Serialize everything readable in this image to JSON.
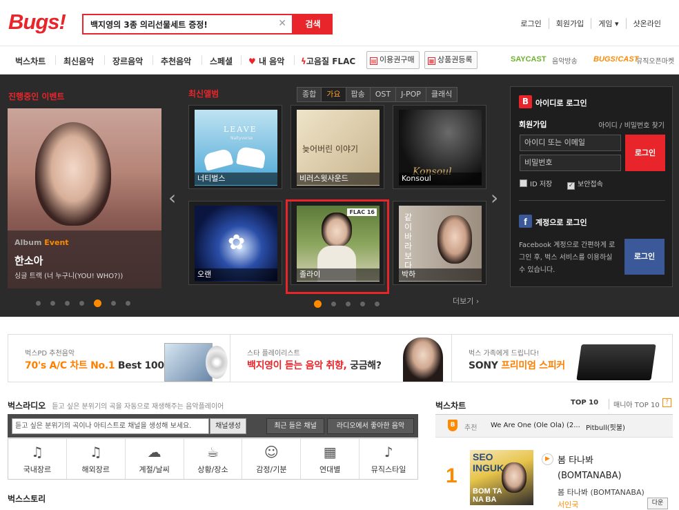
{
  "header": {
    "logo": "Bugs!",
    "search_value": "백지영의 3종 의리선물세트 증정!",
    "search_button": "검색",
    "links": [
      "로그인",
      "회원가입",
      "게임 ▾",
      "샷온라인"
    ]
  },
  "nav": {
    "items": [
      "벅스차트",
      "최신음악",
      "장르음악",
      "추천음악",
      "스페셜",
      "내 음악",
      "고음질 FLAC"
    ],
    "buttons": [
      "이용권구매",
      "상품권등록"
    ],
    "saycast": "SAYCAST",
    "saycast_sub": "음악방송",
    "bugscast": "BUGS!CAST",
    "bugscast_sub": "뮤직오픈마켓"
  },
  "event": {
    "section_title": "진행중인 이벤트",
    "tag1": "Album",
    "tag2": "Event",
    "artist": "한소아",
    "desc": "싱글 트랙 (너 누구니(YOU! WHO?))"
  },
  "albums": {
    "section_title": "최신앨범",
    "tabs": [
      "종합",
      "가요",
      "팝송",
      "OST",
      "J-POP",
      "클래식"
    ],
    "active_tab": "가요",
    "items": [
      {
        "label": "너티벌스",
        "art_text": "LEAVE",
        "art_sub": "Naltyverse"
      },
      {
        "label": "비러스윗사운드",
        "art_text": "늦어버린 이야기"
      },
      {
        "label": "Konsoul",
        "art_text": "Konsoul"
      },
      {
        "label": "오랜",
        "art_text": ""
      },
      {
        "label": "졸라이",
        "art_text": "",
        "badge": "FLAC 16"
      },
      {
        "label": "박하",
        "art_text": "같이 바라보다"
      }
    ],
    "more": "더보기 ›"
  },
  "login": {
    "id_login": "아이디로 로그인",
    "join": "회원가입",
    "find": "아이디 / 비밀번호 찾기",
    "id_placeholder": "아이디 또는 이메일",
    "pw_placeholder": "비밀번호",
    "login_button": "로그인",
    "save_id": "ID 저장",
    "secure": "보안접속",
    "fb_title": "계정으로 로그인",
    "fb_desc": "Facebook 계정으로 간편하게 로그인 후, 벅스 서비스를 이용하실 수 있습니다.",
    "fb_button": "로그인"
  },
  "banner": {
    "b1_small": "벅스PD 추천음악",
    "b1_big_a": "70's A/C 차트 No.1",
    "b1_big_b": "Best 100",
    "b2_small": "스타 플레이리스트",
    "b2_big_a": "백지영이 듣는 음악 취향,",
    "b2_big_b": "궁금해?",
    "b3_small": "벅스 가족에게 드립니다!",
    "b3_big_a": "SONY",
    "b3_big_b": "프리미엄 스피커"
  },
  "radio": {
    "title": "벅스라디오",
    "desc": "듣고 싶은 분위기의 곡을 자동으로 재생해주는 음악플레이어",
    "input_placeholder": "듣고 싶은 분위기의 곡이나 아티스트로 채널을 생성해 보세요.",
    "create": "채널생성",
    "recent": "최근 들은 채널",
    "liked": "라디오에서 좋아한 음악",
    "cats": [
      {
        "label": "국내장르",
        "icon": "music-note-icon"
      },
      {
        "label": "해외장르",
        "icon": "music-note-icon"
      },
      {
        "label": "계절/날씨",
        "icon": "weather-icon"
      },
      {
        "label": "상황/장소",
        "icon": "coffee-icon"
      },
      {
        "label": "감정/기분",
        "icon": "emotion-icon"
      },
      {
        "label": "연대별",
        "icon": "calendar-icon"
      },
      {
        "label": "뮤직스타일",
        "icon": "guitar-icon"
      }
    ]
  },
  "story": {
    "title": "벅스스토리"
  },
  "chart": {
    "title": "벅스차트",
    "top10": "TOP 10",
    "mania": "매니아 TOP 10",
    "help": "?",
    "recommend": "추천",
    "rec_song": "We Are One (Ole Ola) (2...",
    "rec_artist": "Pitbull(핏불)",
    "rank": "1",
    "song": "봄 타나봐 (BOMTANABA)",
    "artist": "봄 타나봐 (BOMTANABA)",
    "artist2": "서인국",
    "download": "다운",
    "cover_text_a": "SEO",
    "cover_text_b": "INGUK",
    "cover_text_c": "BOM TA NA BA"
  }
}
